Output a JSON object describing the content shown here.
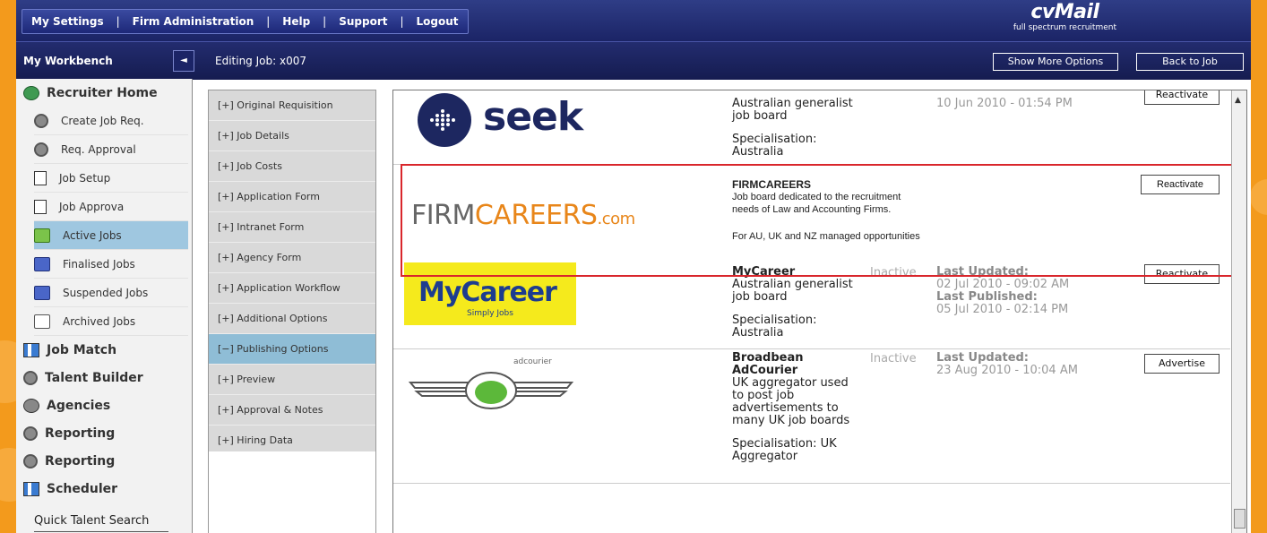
{
  "colors": {
    "accent_orange": "#f39a1c",
    "nav_blue": "#1b2466",
    "active_blue": "#9fc7e0",
    "highlight_red": "#d9262c"
  },
  "nav": {
    "items": [
      "My Settings",
      "Firm Administration",
      "Help",
      "Support",
      "Logout"
    ]
  },
  "logo": {
    "brand": "cvMail",
    "tagline": "full spectrum recruitment"
  },
  "subbar": {
    "workbench": "My Workbench",
    "editing": "Editing Job: x007",
    "show_more": "Show More Options",
    "back": "Back to Job",
    "collapse_icon": "◄"
  },
  "sidebar": {
    "recruiter_home": "Recruiter Home",
    "items": [
      "Create Job Req.",
      "Req. Approval",
      "Job Setup",
      "Job Approva",
      "Active Jobs",
      "Finalised Jobs",
      "Suspended Jobs",
      "Archived Jobs"
    ],
    "sections": [
      "Job Match",
      "Talent Builder",
      "Agencies",
      "Reporting",
      "Reporting",
      "Scheduler"
    ],
    "quick_search": "Quick Talent Search"
  },
  "job_menu": {
    "items": [
      "[+] Original Requisition",
      "[+] Job Details",
      "[+] Job Costs",
      "[+] Application Form",
      "[+] Intranet Form",
      "[+] Agency Form",
      "[+] Application Workflow",
      "[+] Additional Options",
      "[−] Publishing Options",
      "[+] Preview",
      "[+] Approval & Notes",
      "[+] Hiring Data"
    ],
    "active_index": 8
  },
  "boards": {
    "seek": {
      "logo": "seek",
      "desc_line1": "Australian generalist",
      "desc_line2": "job board",
      "spec_label": "Specialisation:",
      "spec_value": "Australia",
      "date": "10 Jun 2010 - 01:54 PM",
      "button": "Reactivate"
    },
    "firmcareers": {
      "logo_firm": "FIRM",
      "logo_careers": "CAREERS",
      "logo_com": ".com",
      "name": "FIRMCAREERS",
      "desc_line1": "Job board dedicated to the recruitment",
      "desc_line2": "needs of Law and Accounting Firms.",
      "note": "For AU, UK and NZ managed opportunities",
      "button": "Reactivate"
    },
    "mycareer": {
      "logo": "MyCareer",
      "logo_sub": "Simply Jobs",
      "name": "MyCareer",
      "status": "Inactive",
      "desc_line1": "Australian generalist",
      "desc_line2": "job board",
      "spec_label": "Specialisation:",
      "spec_value": "Australia",
      "last_updated_label": "Last Updated:",
      "last_updated": "02 Jul 2010 - 09:02 AM",
      "last_published_label": "Last Published:",
      "last_published": "05 Jul 2010 - 02:14 PM",
      "button": "Reactivate"
    },
    "broadbean": {
      "logo_label": "adcourier",
      "name_line1": "Broadbean",
      "name_line2": "AdCourier",
      "status": "Inactive",
      "desc": [
        "UK aggregator used",
        "to post job",
        "advertisements to",
        "many UK job boards"
      ],
      "spec_line1": "Specialisation: UK",
      "spec_line2": "Aggregator",
      "last_updated_label": "Last Updated:",
      "last_updated": "23 Aug 2010 - 10:04 AM",
      "button": "Advertise"
    }
  }
}
